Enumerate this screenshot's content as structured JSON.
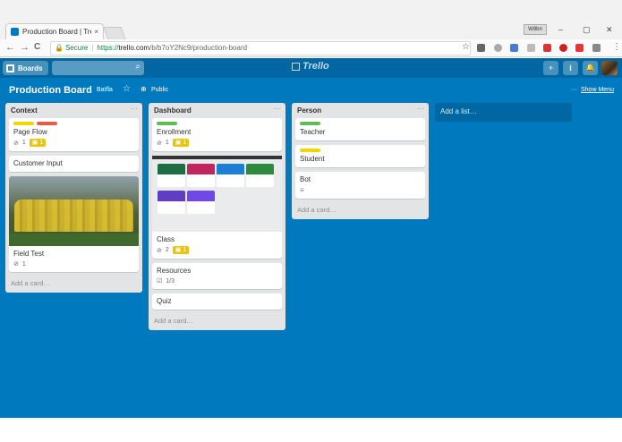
{
  "browser": {
    "tab_title": "Production Board | Trello",
    "tab_close": "×",
    "window_badge": "W8bn",
    "window_controls": [
      "–",
      "▢",
      "✕"
    ],
    "nav": {
      "back": "←",
      "forward": "→",
      "reload": "C"
    },
    "url": {
      "secure_label": "Secure",
      "protocol": "https://",
      "host": "trello.com",
      "path": "/b/b7oY2Nc9/production-board"
    },
    "menu_glyph": "⋮"
  },
  "header": {
    "boards_label": "Boards",
    "logo_text": "Trello",
    "add_glyph": "+",
    "info_glyph": "i",
    "bell_glyph": "🔔"
  },
  "board": {
    "title": "Production Board",
    "team": "Batfla",
    "visibility": "Public",
    "show_menu": "Show Menu",
    "dots": "···"
  },
  "lists": [
    {
      "title": "Context",
      "menu": "···",
      "cards": [
        {
          "title": "Page Flow",
          "labels": [
            "#f2d600",
            "#eb5a46"
          ],
          "attachments": "1",
          "checklist": "1"
        },
        {
          "title": "Customer Input"
        },
        {
          "title": "Field Test",
          "has_photo": true,
          "attachments": "1"
        }
      ],
      "add_card": "Add a card…"
    },
    {
      "title": "Dashboard",
      "menu": "···",
      "cards": [
        {
          "title": "Enrollment",
          "labels": [
            "#61bd4f"
          ],
          "attachments": "1",
          "checklist": "1"
        },
        {
          "title": "Class",
          "has_thumb": true,
          "attachments": "2",
          "checklist": "1"
        },
        {
          "title": "Resources",
          "checklist_progress": "1/3"
        },
        {
          "title": "Quiz"
        }
      ],
      "add_card": "Add a card…"
    },
    {
      "title": "Person",
      "menu": "···",
      "cards": [
        {
          "title": "Teacher",
          "labels": [
            "#61bd4f"
          ]
        },
        {
          "title": "Student",
          "labels": [
            "#f2d600"
          ]
        },
        {
          "title": "Bot",
          "has_description": true
        }
      ],
      "add_card": "Add a card…"
    }
  ],
  "add_list": "Add a list…",
  "colors": {
    "board_bg": "#0079bf",
    "header_bg": "#0067a3",
    "list_bg": "#e2e4e6",
    "checklist_badge": "#e6c60d"
  }
}
